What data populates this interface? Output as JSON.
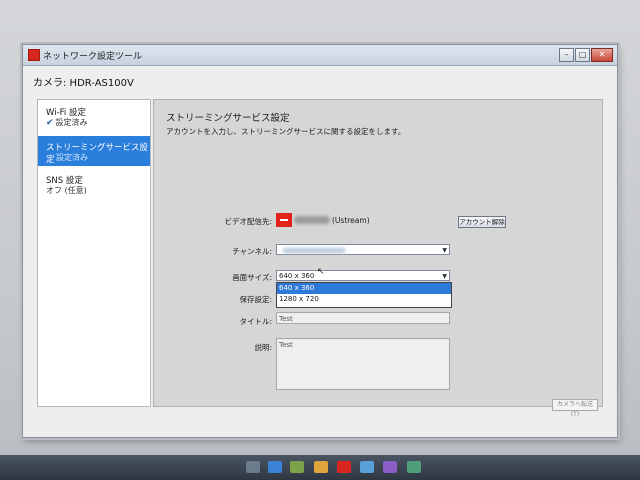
{
  "window": {
    "title": "ネットワーク設定ツール",
    "buttons": {
      "minimize": "–",
      "maximize": "□",
      "close": "✕"
    }
  },
  "camera_label": "カメラ: HDR-AS100V",
  "sidebar": {
    "items": [
      {
        "name": "Wi-Fi 設定",
        "status": "設定済み",
        "status_icon": "check-icon"
      },
      {
        "name": "ストリーミングサービス設定",
        "status": "設定済み"
      },
      {
        "name": "SNS 設定",
        "status": "オフ (任意)"
      }
    ]
  },
  "main": {
    "title": "ストリーミングサービス設定",
    "description": "アカウントを入力し、ストリーミングサービスに関する設定をします。",
    "fields": {
      "video_service_label": "ビデオ配信先:",
      "service_name": "(Ustream)",
      "account_button": "アカウント解除",
      "channel_label": "チャンネル:",
      "screen_size_label": "画面サイズ:",
      "screen_size_value": "640 x 360",
      "screen_size_options": [
        "640 x 360",
        "1280 x 720"
      ],
      "save_label": "保存設定:",
      "title_label": "タイトル:",
      "title_value": "Test",
      "description_label": "説明:",
      "description_value": "Test"
    },
    "footer_button": "カメラへ転送(T)"
  },
  "colors": {
    "accent": "#2b7fdc",
    "brand": "#e2231a"
  }
}
